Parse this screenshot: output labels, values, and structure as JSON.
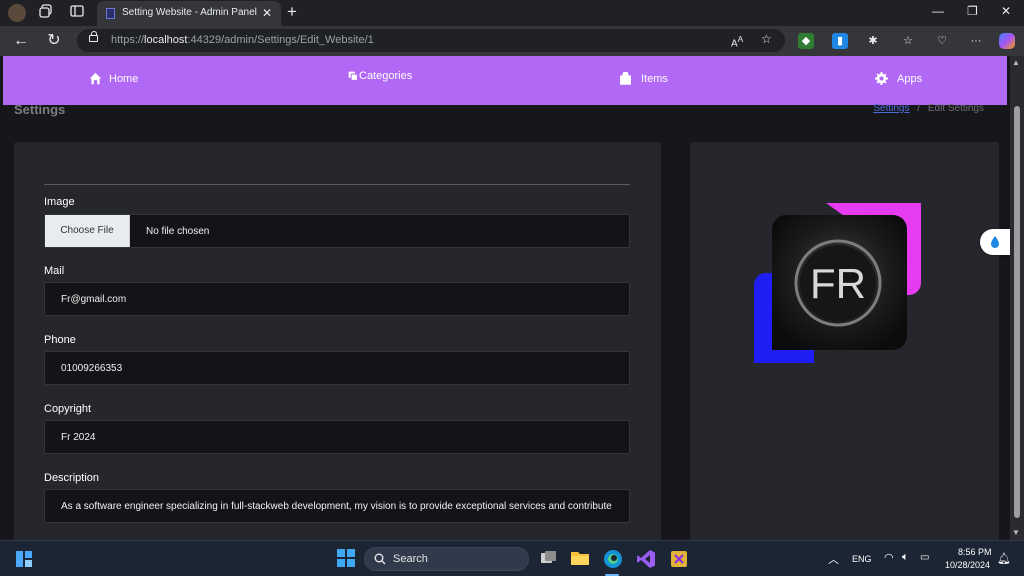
{
  "browser": {
    "tab_title": "Setting Website - Admin Panel",
    "url_prefix": "https://",
    "url_host": "localhost",
    "url_rest": ":44329/admin/Settings/Edit_Website/1"
  },
  "navbar": {
    "bg_color": "#b068f5",
    "items": [
      {
        "label": "Home",
        "icon": "home-icon"
      },
      {
        "label": "Categories",
        "icon": "copy-icon"
      },
      {
        "label": "Items",
        "icon": "shopping-bag-icon"
      },
      {
        "label": "Apps",
        "icon": "gear-icon"
      }
    ]
  },
  "page": {
    "heading": "Settings",
    "breadcrumb_link": "Settings",
    "breadcrumb_sep": "/",
    "breadcrumb_current": "Edit Settings"
  },
  "form": {
    "image": {
      "label": "Image",
      "button": "Choose File",
      "status": "No file chosen"
    },
    "mail": {
      "label": "Mail",
      "value": "Fr@gmail.com"
    },
    "phone": {
      "label": "Phone",
      "value": "01009266353"
    },
    "copyright": {
      "label": "Copyright",
      "value": "Fr 2024"
    },
    "description": {
      "label": "Description",
      "value": "As a software engineer specializing in full-stackweb development, my vision is to provide exceptional services and contribute"
    }
  },
  "logo": {
    "text": "FR",
    "accent_pink": "#e63bf0",
    "accent_blue": "#1f1ff5"
  },
  "taskbar": {
    "search_label": "Search",
    "language": "ENG",
    "time": "8:56 PM",
    "date": "10/28/2024"
  }
}
